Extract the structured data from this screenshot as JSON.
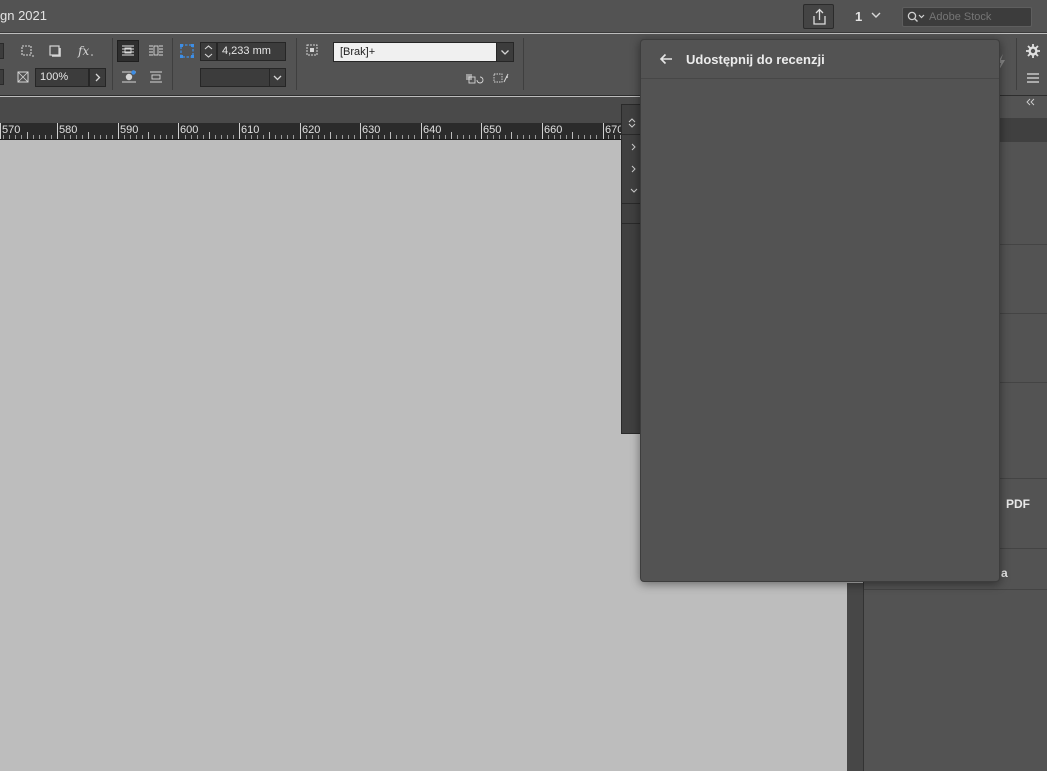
{
  "app": {
    "title_fragment": "gn 2021"
  },
  "titlebar": {
    "page_count": "1",
    "stock_placeholder": "Adobe Stock"
  },
  "controlbar": {
    "opacity_value": "100%",
    "stroke_weight_value": "4,233 mm",
    "object_style_value": "[Brak]+"
  },
  "ruler": {
    "labels": [
      "570",
      "580",
      "590",
      "600",
      "610",
      "620",
      "630",
      "640",
      "650",
      "660",
      "670"
    ]
  },
  "popover": {
    "title": "Udostępnij do recenzji"
  },
  "right_panel": {
    "item_pdf_fragment": "PDF",
    "item_a_fragment": "a"
  },
  "colors": {
    "ui_bg": "#535353",
    "canvas_bg": "#bdbdbd",
    "ruler_bg": "#2b2b2b",
    "accent": "#3d8ee6"
  }
}
